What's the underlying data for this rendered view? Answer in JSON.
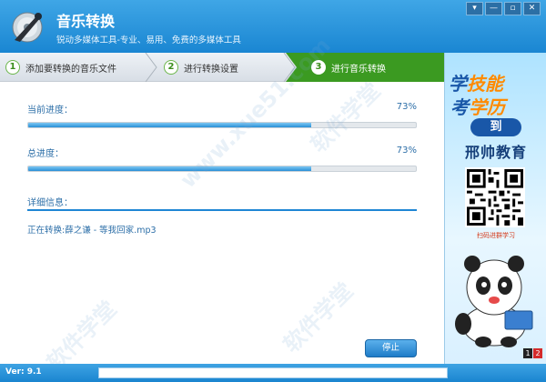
{
  "app": {
    "title": "音乐转换",
    "subtitle": "锐动多媒体工具-专业、易用、免费的多媒体工具",
    "window_controls": [
      "▾",
      "—",
      "▫",
      "✕"
    ]
  },
  "steps": [
    {
      "number": "1",
      "label": "添加要转换的音乐文件",
      "state": "done"
    },
    {
      "number": "2",
      "label": "进行转换设置",
      "state": "done"
    },
    {
      "number": "3",
      "label": "进行音乐转换",
      "state": "active"
    }
  ],
  "progress": {
    "current_label": "当前进度：",
    "current_percent": "73%",
    "current_value": 0.73,
    "total_label": "总进度：",
    "total_percent": "73%",
    "total_value": 0.73,
    "detail_label": "详细信息：",
    "current_file": "正在转换:薛之谦 - 等我回家.mp3"
  },
  "stop_button": "停止",
  "ad": {
    "line1_a": "学",
    "line1_b": "技能",
    "line2_a": "考",
    "line2_b": "学历",
    "dao": "到",
    "brand": "邢帅教育",
    "scan": "扫码进群学习",
    "pages": [
      "1",
      "2"
    ]
  },
  "status": {
    "version": "Ver: 9.1"
  },
  "watermark": {
    "text_cn": "软件学堂",
    "text_en": "www.xue51.com"
  },
  "colors": {
    "title_bar": "#1a86d2",
    "step_active": "#3b9a21",
    "progress_fill": "#2a8fd6",
    "label_text": "#2d6fa8"
  }
}
